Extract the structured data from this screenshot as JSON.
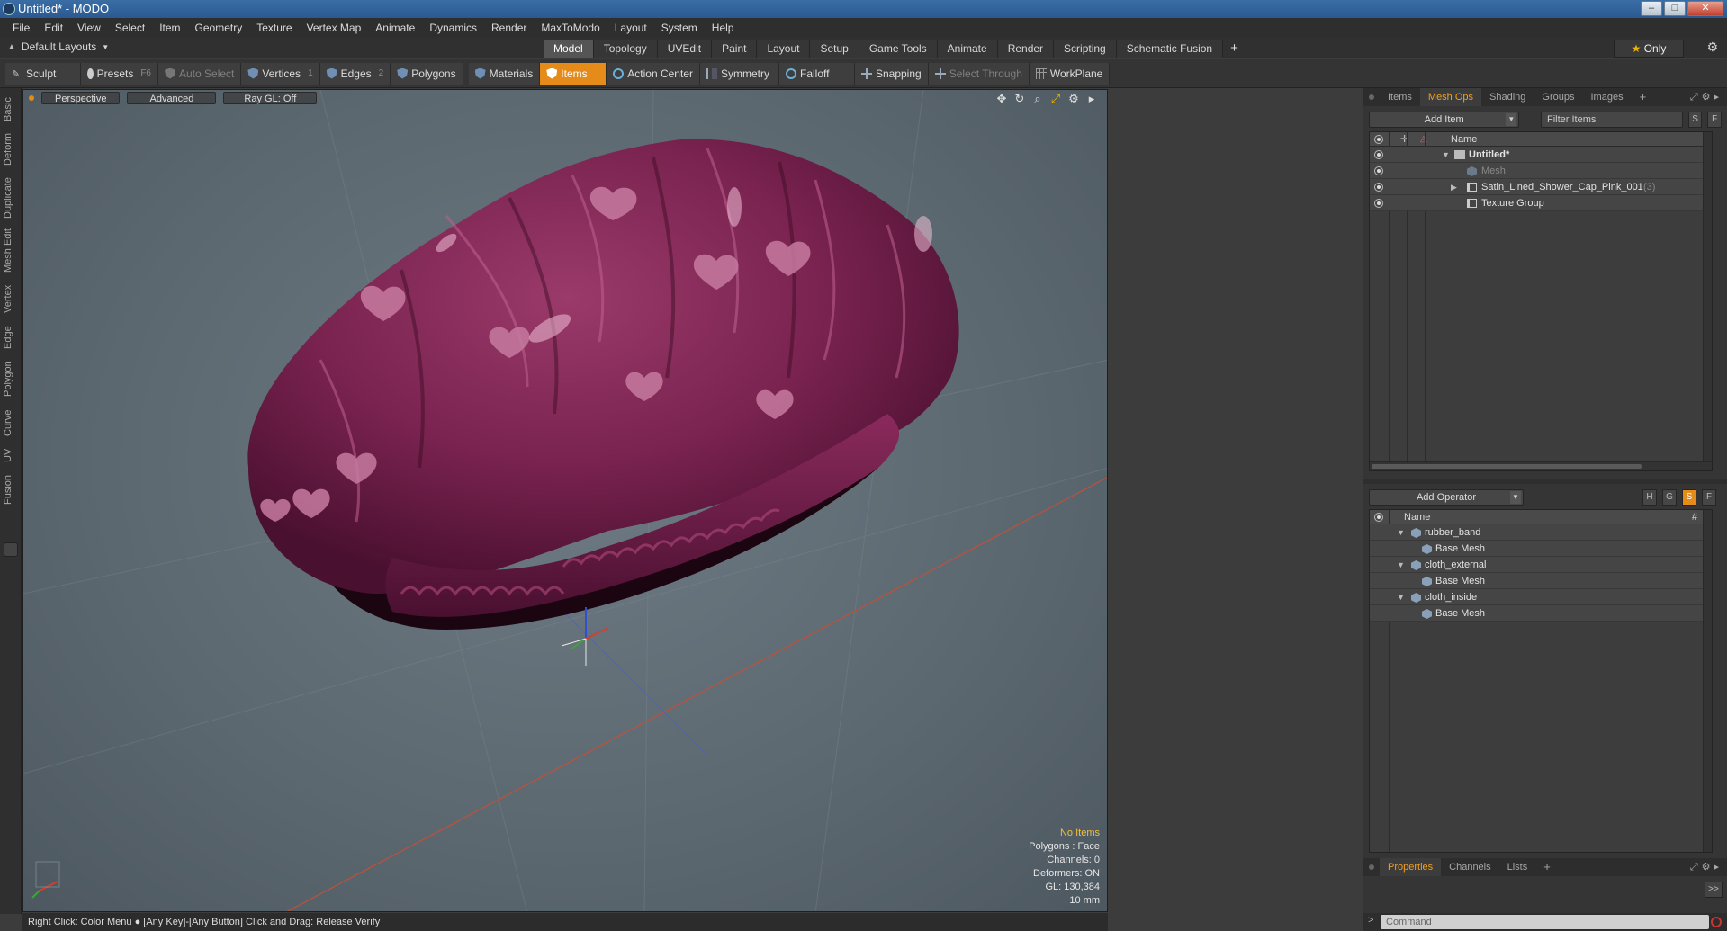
{
  "window": {
    "title": "Untitled* - MODO",
    "min_glyph": "–",
    "max_glyph": "□",
    "close_glyph": "✕"
  },
  "menu": [
    "File",
    "Edit",
    "View",
    "Select",
    "Item",
    "Geometry",
    "Texture",
    "Vertex Map",
    "Animate",
    "Dynamics",
    "Render",
    "MaxToModo",
    "Layout",
    "System",
    "Help"
  ],
  "layout_bar": {
    "layout_label": "Default Layouts",
    "tabs": [
      {
        "label": "Model",
        "active": true
      },
      {
        "label": "Topology",
        "active": false
      },
      {
        "label": "UVEdit",
        "active": false
      },
      {
        "label": "Paint",
        "active": false
      },
      {
        "label": "Layout",
        "active": false
      },
      {
        "label": "Setup",
        "active": false
      },
      {
        "label": "Game Tools",
        "active": false
      },
      {
        "label": "Animate",
        "active": false
      },
      {
        "label": "Render",
        "active": false
      },
      {
        "label": "Scripting",
        "active": false
      },
      {
        "label": "Schematic Fusion",
        "active": false
      }
    ],
    "add_glyph": "+",
    "only_label": "Only",
    "star_glyph": "★"
  },
  "toolbar": {
    "sculpt": "Sculpt",
    "presets": "Presets",
    "presets_key": "F6",
    "auto_select": "Auto Select",
    "vertices": "Vertices",
    "vertices_count": "1",
    "edges": "Edges",
    "edges_count": "2",
    "polygons": "Polygons",
    "materials": "Materials",
    "items": "Items",
    "action_center": "Action Center",
    "symmetry": "Symmetry",
    "falloff": "Falloff",
    "snapping": "Snapping",
    "select_through": "Select Through",
    "workplane": "WorkPlane"
  },
  "sidetabs": [
    "Basic",
    "Deform",
    "Duplicate",
    "Mesh Edit",
    "Vertex",
    "Edge",
    "Polygon",
    "Curve",
    "UV",
    "Fusion"
  ],
  "viewport": {
    "perspective": "Perspective",
    "advanced": "Advanced",
    "raygl": "Ray GL: Off",
    "info": {
      "no_items": "No Items",
      "polygons": "Polygons : Face",
      "channels": "Channels: 0",
      "deformers": "Deformers: ON",
      "gl": "GL: 130,384",
      "scale": "10 mm"
    },
    "colors": {
      "cap": "#7a2350",
      "cap_dark": "#4a1030",
      "heart": "#c77aa0",
      "x_axis": "#d04030",
      "y_axis": "#4060d0",
      "z_axis": "#40a040"
    }
  },
  "statusbar": {
    "text": "Right Click: Color Menu ● [Any Key]-[Any Button] Click and Drag: Release Verify"
  },
  "items_panel": {
    "tabs": [
      {
        "label": "Items",
        "active": false
      },
      {
        "label": "Mesh Ops",
        "active": true
      },
      {
        "label": "Shading",
        "active": false
      },
      {
        "label": "Groups",
        "active": false
      },
      {
        "label": "Images",
        "active": false
      }
    ],
    "add_item": "Add Item",
    "filter_placeholder": "Filter Items",
    "s_btn": "S",
    "f_btn": "F",
    "col_name": "Name",
    "rows": [
      {
        "label": "Untitled*",
        "bold": true,
        "dim": false
      },
      {
        "label": "Mesh",
        "bold": false,
        "dim": true
      },
      {
        "label": "Satin_Lined_Shower_Cap_Pink_001",
        "suffix": "(3)",
        "bold": false,
        "dim": false
      },
      {
        "label": "Texture Group",
        "bold": false,
        "dim": false
      }
    ]
  },
  "meshops_panel": {
    "add_operator": "Add Operator",
    "h_btn": "H",
    "g_btn": "G",
    "s_btn": "S",
    "f_btn": "F",
    "col_name": "Name",
    "col_hash": "#",
    "rows": [
      {
        "label": "rubber_band",
        "level": 0
      },
      {
        "label": "Base Mesh",
        "level": 1
      },
      {
        "label": "cloth_external",
        "level": 0
      },
      {
        "label": "Base Mesh",
        "level": 1
      },
      {
        "label": "cloth_inside",
        "level": 0
      },
      {
        "label": "Base Mesh",
        "level": 1
      }
    ]
  },
  "properties_panel": {
    "tabs": [
      {
        "label": "Properties",
        "active": true
      },
      {
        "label": "Channels",
        "active": false
      },
      {
        "label": "Lists",
        "active": false
      }
    ],
    "expand_glyph": ">>"
  },
  "command": {
    "prompt": ">",
    "placeholder": "Command"
  }
}
